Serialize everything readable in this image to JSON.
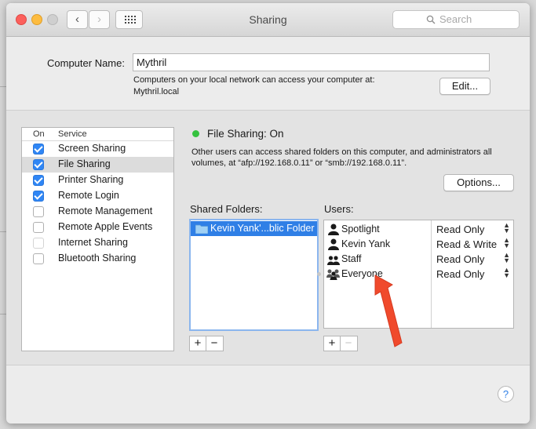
{
  "window": {
    "title": "Sharing",
    "search_placeholder": "Search",
    "back_label": "‹",
    "forward_label": "›"
  },
  "computer": {
    "name_label": "Computer Name:",
    "name_value": "Mythril",
    "info_line1": "Computers on your local network can access your computer at:",
    "info_line2": "Mythril.local",
    "edit_label": "Edit..."
  },
  "services": {
    "col_on": "On",
    "col_service": "Service",
    "items": [
      {
        "label": "Screen Sharing",
        "checked": true
      },
      {
        "label": "File Sharing",
        "checked": true,
        "selected": true
      },
      {
        "label": "Printer Sharing",
        "checked": true
      },
      {
        "label": "Remote Login",
        "checked": true
      },
      {
        "label": "Remote Management",
        "checked": false
      },
      {
        "label": "Remote Apple Events",
        "checked": false
      },
      {
        "label": "Internet Sharing",
        "checked": false,
        "disabled": true
      },
      {
        "label": "Bluetooth Sharing",
        "checked": false
      }
    ]
  },
  "status": {
    "title": "File Sharing: On",
    "color": "#35c23f",
    "desc_line1": "Other users can access shared folders on this computer, and administrators all",
    "desc_line2": "volumes, at “afp://192.168.0.11” or “smb://192.168.0.11”.",
    "options_label": "Options..."
  },
  "shared_folders": {
    "label": "Shared Folders:",
    "items": [
      "Kevin Yank'...blic Folder"
    ],
    "add_label": "+",
    "remove_label": "−"
  },
  "users": {
    "label": "Users:",
    "items": [
      {
        "name": "Spotlight",
        "icon": "user-icon",
        "permission": "Read Only"
      },
      {
        "name": "Kevin Yank",
        "icon": "user-icon",
        "permission": "Read & Write"
      },
      {
        "name": "Staff",
        "icon": "group-icon",
        "permission": "Read Only"
      },
      {
        "name": "Everyone",
        "icon": "everyone-icon",
        "permission": "Read Only"
      }
    ],
    "add_label": "+",
    "remove_label": "−"
  },
  "help_label": "?",
  "colors": {
    "selection": "#2f7fe6",
    "arrow": "#f04a2c"
  }
}
